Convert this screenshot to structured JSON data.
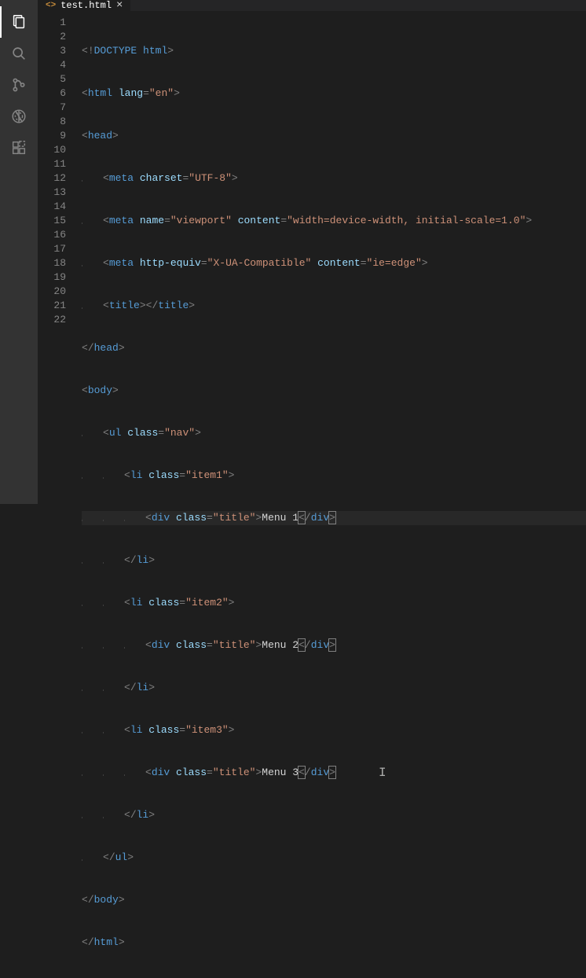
{
  "activity_bar": {
    "items": [
      {
        "name": "explorer-icon",
        "active": true
      },
      {
        "name": "search-icon",
        "active": false
      },
      {
        "name": "source-control-icon",
        "active": false
      },
      {
        "name": "debug-icon",
        "active": false
      },
      {
        "name": "extensions-icon",
        "active": false
      }
    ]
  },
  "tab": {
    "icon_label": "<>",
    "filename": "test.html",
    "close_glyph": "×"
  },
  "line_numbers": [
    "1",
    "2",
    "3",
    "4",
    "5",
    "6",
    "7",
    "8",
    "9",
    "10",
    "11",
    "12",
    "13",
    "14",
    "15",
    "16",
    "17",
    "18",
    "19",
    "20",
    "21",
    "22"
  ],
  "tokens": {
    "lt": "<",
    "gt": ">",
    "sl": "/",
    "eq": "=",
    "bang": "!",
    "doctype": "DOCTYPE",
    "html": "html",
    "head": "head",
    "meta": "meta",
    "title": "title",
    "body": "body",
    "ul": "ul",
    "li": "li",
    "div": "div",
    "a_lang": "lang",
    "a_charset": "charset",
    "a_name": "name",
    "a_content": "content",
    "a_httpequiv": "http-equiv",
    "a_class": "class",
    "v_en": "\"en\"",
    "v_utf8": "\"UTF-8\"",
    "v_viewport": "\"viewport\"",
    "v_vpcontent": "\"width=device-width, initial-scale=1.0\"",
    "v_xua": "\"X-UA-Compatible\"",
    "v_ieedge": "\"ie=edge\"",
    "v_nav": "\"nav\"",
    "v_item1": "\"item1\"",
    "v_item2": "\"item2\"",
    "v_item3": "\"item3\"",
    "v_title": "\"title\"",
    "menu1": "Menu 1",
    "menu2": "Menu 2",
    "menu3": "Menu 3",
    "sp": " "
  },
  "cursor": {
    "line": 18,
    "glyph": "I"
  }
}
